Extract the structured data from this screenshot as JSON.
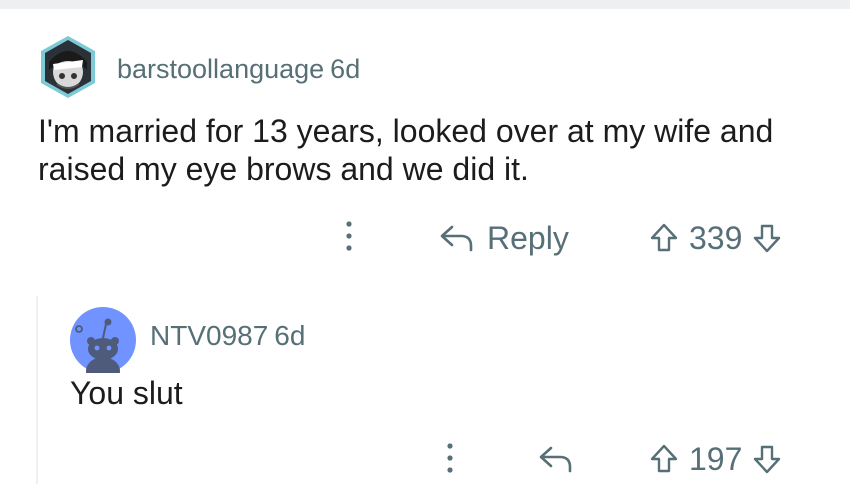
{
  "comment_1": {
    "username": "barstoollanguage",
    "age": "6d",
    "body": "I'm married for 13 years, looked over at my wife and raised my eye brows and we did it.",
    "reply_label": "Reply",
    "score": "339"
  },
  "comment_2": {
    "username": "NTV0987",
    "age": "6d",
    "body": "You slut",
    "score": "197"
  },
  "colors": {
    "meta_text": "#576f76",
    "body_text": "#1c1c1c",
    "default_avatar_blue": "#7193ff",
    "thread_line": "#edeff1"
  },
  "icons": [
    "more-vertical-icon",
    "reply-arrow-icon",
    "upvote-icon",
    "downvote-icon"
  ]
}
